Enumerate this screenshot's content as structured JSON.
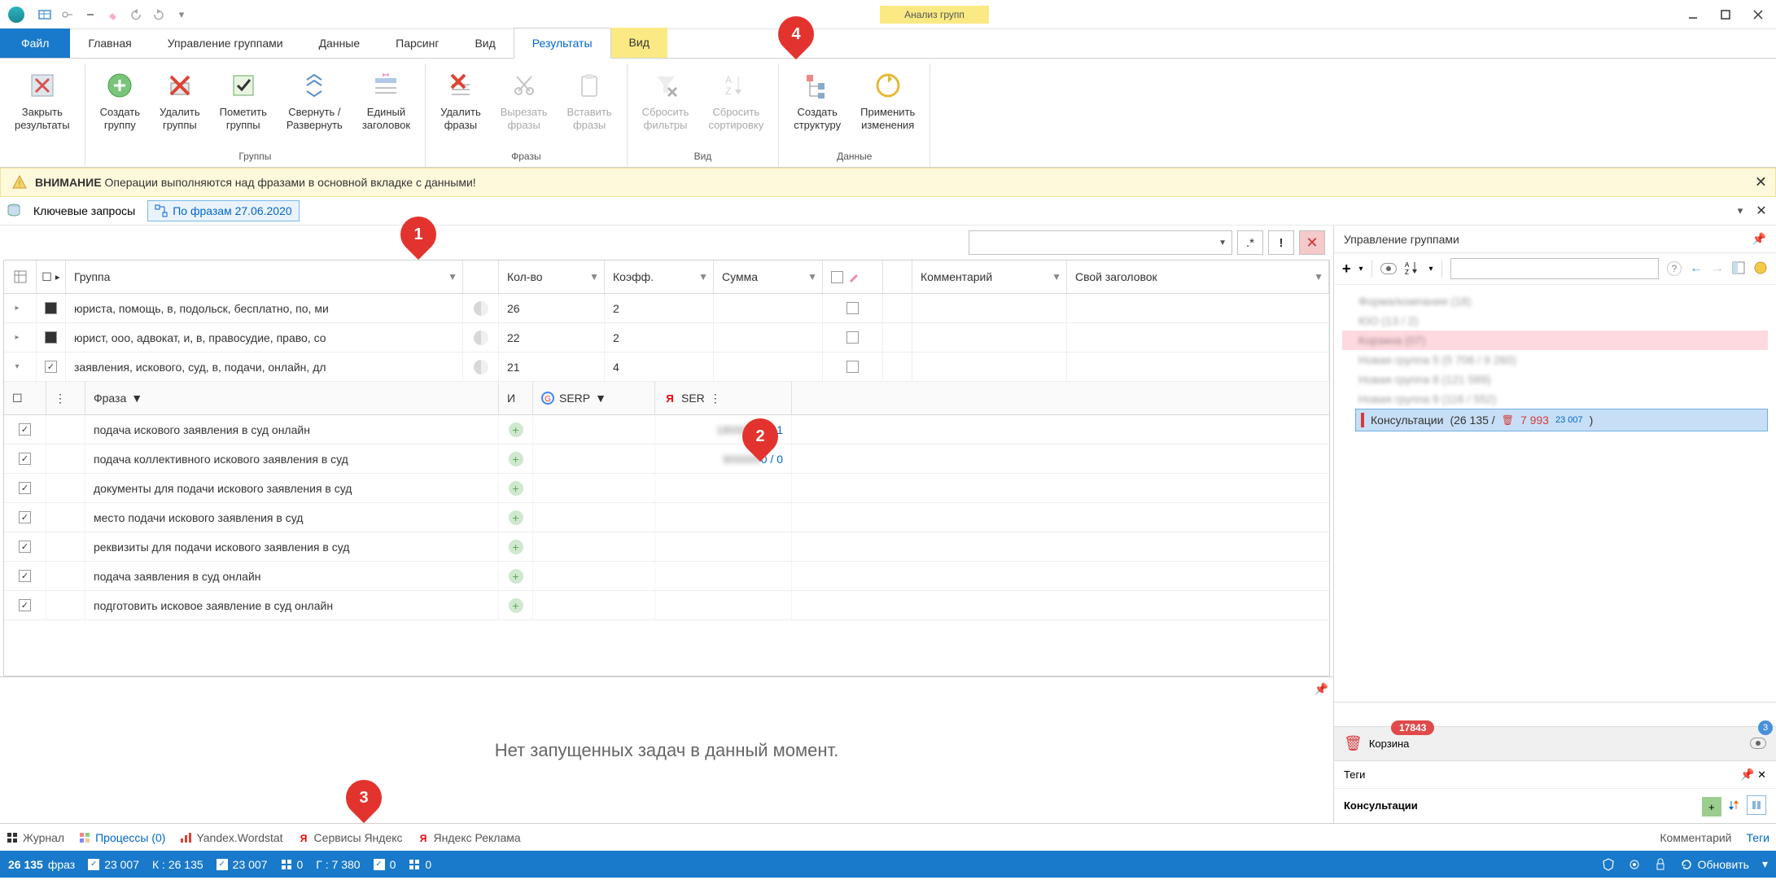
{
  "contextHeader": "Анализ групп",
  "ribbonTabs": {
    "file": "Файл",
    "main": "Главная",
    "groups": "Управление группами",
    "data": "Данные",
    "parsing": "Парсинг",
    "view": "Вид",
    "results": "Результаты",
    "contextView": "Вид"
  },
  "ribbon": {
    "closeResults": "Закрыть\nрезультаты",
    "createGroup": "Создать\nгруппу",
    "deleteGroups": "Удалить\nгруппы",
    "markGroups": "Пометить\nгруппы",
    "collapseExpand": "Свернуть /\nРазвернуть",
    "singleHeader": "Единый\nзаголовок",
    "deletePhrases": "Удалить\nфразы",
    "cutPhrases": "Вырезать\nфразы",
    "pastePhrases": "Вставить\nфразы",
    "resetFilters": "Сбросить\nфильтры",
    "resetSort": "Сбросить\nсортировку",
    "createStructure": "Создать\nструктуру",
    "applyChanges": "Применить\nизменения",
    "grpGroups": "Группы",
    "grpPhrases": "Фразы",
    "grpView": "Вид",
    "grpData": "Данные"
  },
  "warning": {
    "bold": "ВНИМАНИЕ",
    "text": " Операции выполняются над фразами в основной вкладке с данными!"
  },
  "innerTabs": {
    "keywords": "Ключевые запросы",
    "byPhrases": "По фразам 27.06.2020"
  },
  "gridHeaders": {
    "group": "Группа",
    "qty": "Кол-во",
    "coef": "Коэфф.",
    "sum": "Сумма",
    "comment": "Комментарий",
    "custom": "Свой заголовок"
  },
  "groupsRows": [
    {
      "expanded": false,
      "checked": "filled",
      "name": "юриста, помощь, в, подольск, бесплатно, по, ми",
      "qty": "26",
      "coef": "2"
    },
    {
      "expanded": false,
      "checked": "filled",
      "name": "юрист, ооо, адвокат, и, в, правосудие, право, со",
      "qty": "22",
      "coef": "2"
    },
    {
      "expanded": true,
      "checked": "checked",
      "name": "заявления, искового, суд, в, подачи, онлайн, дл",
      "qty": "21",
      "coef": "4"
    }
  ],
  "subHeaders": {
    "phrase": "Фраза",
    "and": "И",
    "gserp": "SERP",
    "yserp": "SER"
  },
  "subRows": [
    {
      "phrase": "подача искового заявления в суд онлайн",
      "y1": "1800000",
      "y2": "0 / 1"
    },
    {
      "phrase": "подача коллективного искового заявления в суд",
      "y1": "900000",
      "y2": "0 / 0"
    },
    {
      "phrase": "документы для подачи искового заявления в суд"
    },
    {
      "phrase": "место подачи искового заявления в суд"
    },
    {
      "phrase": "реквизиты для подачи искового заявления в суд"
    },
    {
      "phrase": "подача заявления в суд онлайн"
    },
    {
      "phrase": "подготовить исковое заявление в суд онлайн"
    }
  ],
  "taskMessage": "Нет запущенных задач в данный момент.",
  "bottomTabs": {
    "journal": "Журнал",
    "processes": "Процессы (0)",
    "wordstat": "Yandex.Wordstat",
    "services": "Сервисы Яндекс",
    "ads": "Яндекс Реклама",
    "rComment": "Комментарий",
    "rTags": "Теги"
  },
  "status": {
    "phrases": "26 135",
    "phrasesLabel": "фраз",
    "checkA": "23 007",
    "K": "К : 26 135",
    "checkB": "23 007",
    "zeroA": "0",
    "G": "Г : 7 380",
    "checkC": "0",
    "zeroB": "0",
    "refresh": "Обновить"
  },
  "right": {
    "title": "Управление группами",
    "tree": [
      {
        "label": "Форма/компания (18)"
      },
      {
        "label": "ЮО (13 / 2)"
      },
      {
        "label": "Корзина (07)",
        "hilite": true
      },
      {
        "label": "Новая группа 5 (5 706 / 9 260)"
      },
      {
        "label": "Новая группа 8 (121 589)"
      },
      {
        "label": "Новая группа 9 (116 / 552)"
      }
    ],
    "selected": {
      "name": "Консультации",
      "count": "(26 135 /",
      "trash": "7 993",
      "extra": "23 007",
      "close": ")"
    },
    "trash": {
      "label": "Корзина",
      "badge": "17843"
    },
    "tagsTitle": "Теги",
    "tagSelected": "Консультации"
  },
  "markers": {
    "m1": "1",
    "m2": "2",
    "m3": "3",
    "m4": "4"
  }
}
